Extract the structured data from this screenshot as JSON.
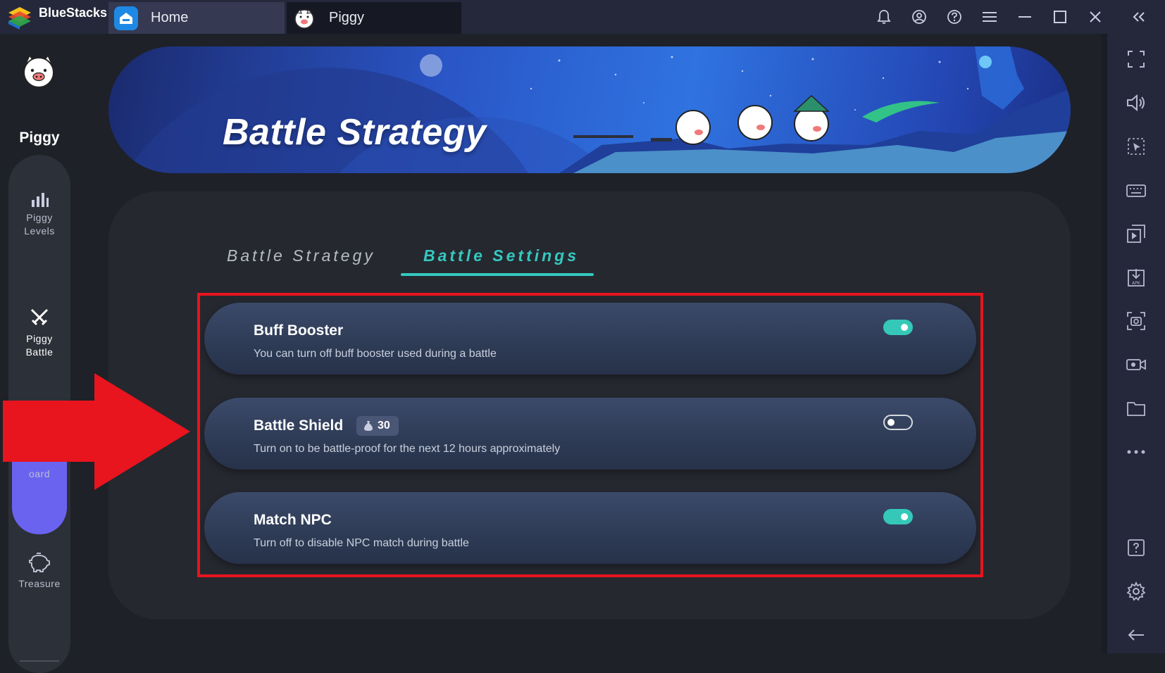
{
  "titlebar": {
    "app_name": "BlueStacks",
    "tabs": [
      {
        "label": "Home",
        "icon": "home-icon"
      },
      {
        "label": "Piggy",
        "icon": "piggy-icon"
      }
    ],
    "icons": [
      "bell-icon",
      "account-icon",
      "help-icon",
      "menu-icon",
      "minimize-icon",
      "maximize-icon",
      "close-icon",
      "collapse-sidebar-icon"
    ]
  },
  "app": {
    "name": "Piggy"
  },
  "sidebar": {
    "items": [
      {
        "label": "Piggy\nLevels",
        "line1": "Piggy",
        "line2": "Levels",
        "icon": "bar-chart-icon",
        "active": false
      },
      {
        "label": "Piggy Battle",
        "line1": "Piggy",
        "line2": "Battle",
        "icon": "crossed-swords-icon",
        "active": true
      },
      {
        "label": "oard",
        "icon": "leaderboard-icon",
        "active": false
      },
      {
        "label": "Treasure",
        "icon": "piggy-bank-icon",
        "active": false
      }
    ]
  },
  "banner": {
    "title": "Battle Strategy"
  },
  "panel": {
    "tabs": [
      {
        "label": "Battle Strategy",
        "active": false
      },
      {
        "label": "Battle Settings",
        "active": true
      }
    ],
    "settings": [
      {
        "title": "Buff Booster",
        "description": "You can turn off buff booster used during a battle",
        "enabled": true
      },
      {
        "title": "Battle Shield",
        "badge": "30",
        "description": "Turn on to be battle-proof for the next 12 hours approximately",
        "enabled": false
      },
      {
        "title": "Match NPC",
        "description": "Turn off to disable NPC match during battle",
        "enabled": true
      }
    ]
  },
  "rightbar": {
    "icons": [
      "fullscreen-icon",
      "volume-icon",
      "select-region-icon",
      "keyboard-icon",
      "multi-instance-icon",
      "install-apk-icon",
      "screenshot-icon",
      "record-icon",
      "folder-icon",
      "more-icon",
      "help-box-icon",
      "settings-gear-icon",
      "back-arrow-icon"
    ]
  },
  "colors": {
    "accent": "#35c8c0",
    "active_nav": "#6a63f0",
    "highlight_box": "#e8141e",
    "background": "#1e2128"
  }
}
